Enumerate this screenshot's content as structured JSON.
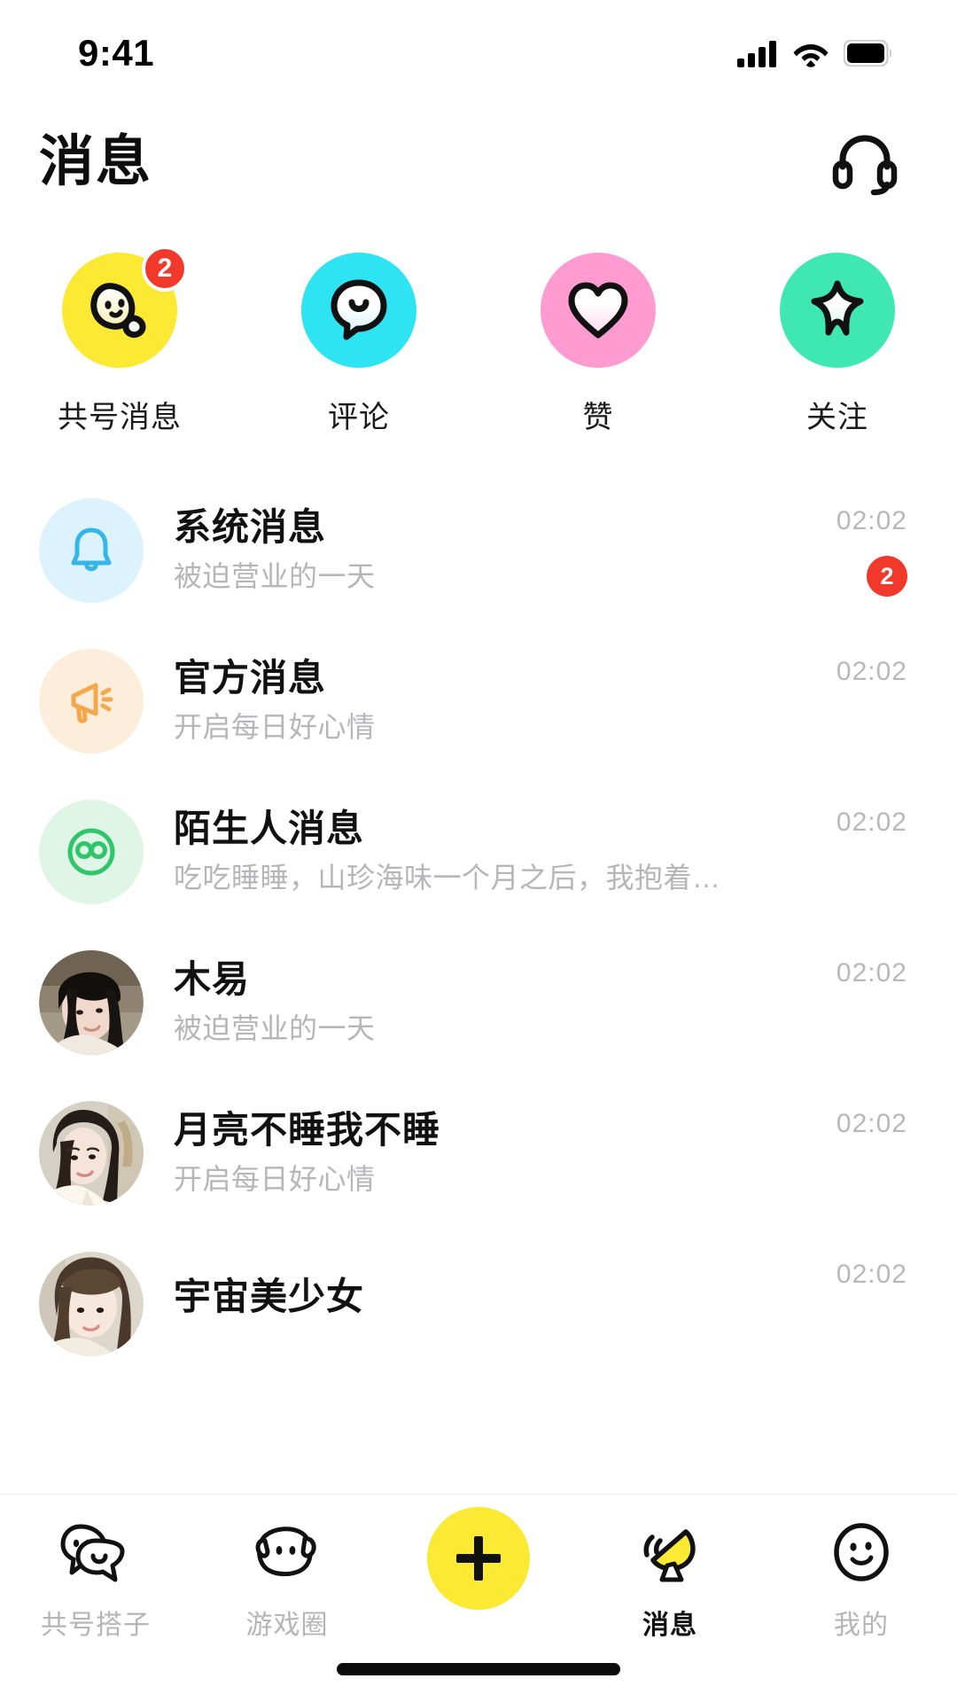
{
  "status_bar": {
    "time": "9:41",
    "icons": [
      "signal-icon",
      "wifi-icon",
      "battery-icon"
    ]
  },
  "header": {
    "title": "消息",
    "action_icon": "headset-icon"
  },
  "categories": [
    {
      "label": "共号消息",
      "icon": "blob-face-icon",
      "bg": "#FCE933",
      "badge": "2"
    },
    {
      "label": "评论",
      "icon": "speech-bubble-icon",
      "bg": "#2FE4F2",
      "badge": ""
    },
    {
      "label": "赞",
      "icon": "heart-icon",
      "bg": "#FF9BD0",
      "badge": ""
    },
    {
      "label": "关注",
      "icon": "star-icon",
      "bg": "#3FE8B0",
      "badge": ""
    }
  ],
  "messages": [
    {
      "name": "系统消息",
      "preview": "被迫营业的一天",
      "time": "02:02",
      "badge": "2",
      "avatar_type": "icon",
      "avatar_icon": "bell-icon",
      "avatar_bg": "#DCF2FC",
      "avatar_fg": "#35B6E8"
    },
    {
      "name": "官方消息",
      "preview": "开启每日好心情",
      "time": "02:02",
      "badge": "",
      "avatar_type": "icon",
      "avatar_icon": "megaphone-icon",
      "avatar_bg": "#FDEEDC",
      "avatar_fg": "#F5A74B"
    },
    {
      "name": "陌生人消息",
      "preview": "吃吃睡睡，山珍海味一个月之后，我抱着…",
      "time": "02:02",
      "badge": "",
      "avatar_type": "icon",
      "avatar_icon": "stranger-face-icon",
      "avatar_bg": "#DFF6E6",
      "avatar_fg": "#30C46B"
    },
    {
      "name": "木易",
      "preview": "被迫营业的一天",
      "time": "02:02",
      "badge": "",
      "avatar_type": "photo",
      "avatar_icon": "user-photo-avatar",
      "avatar_bg": "#8a7f6d",
      "avatar_fg": "#1b1714"
    },
    {
      "name": "月亮不睡我不睡",
      "preview": "开启每日好心情",
      "time": "02:02",
      "badge": "",
      "avatar_type": "photo",
      "avatar_icon": "user-photo-avatar",
      "avatar_bg": "#cfc9bf",
      "avatar_fg": "#2d231c"
    },
    {
      "name": "宇宙美少女",
      "preview": "",
      "time": "02:02",
      "badge": "",
      "avatar_type": "photo",
      "avatar_icon": "user-photo-avatar",
      "avatar_bg": "#d8d2c8",
      "avatar_fg": "#4a3a2c"
    }
  ],
  "tabbar": {
    "items": [
      {
        "label": "共号搭子",
        "icon": "two-blobs-icon",
        "active": false
      },
      {
        "label": "游戏圈",
        "icon": "game-blob-icon",
        "active": false
      },
      {
        "label": "",
        "icon": "plus-icon",
        "active": false
      },
      {
        "label": "消息",
        "icon": "satellite-dish-icon",
        "active": true
      },
      {
        "label": "我的",
        "icon": "smiley-face-icon",
        "active": false
      }
    ]
  },
  "colors": {
    "accent_yellow": "#FCE933",
    "badge_red": "#F0392B",
    "muted_text": "#B6B6B8",
    "primary_text": "#111111"
  }
}
